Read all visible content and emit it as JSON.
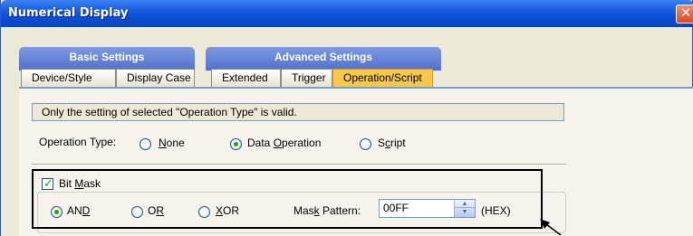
{
  "window": {
    "title": "Numerical Display",
    "close_glyph": "✕"
  },
  "tab_groups": [
    {
      "label": "Basic Settings"
    },
    {
      "label": "Advanced Settings"
    }
  ],
  "tabs": [
    {
      "label": "Device/Style",
      "active": false
    },
    {
      "label": "Display Case",
      "active": false
    },
    {
      "label": "Extended",
      "active": false
    },
    {
      "label": "Trigger",
      "active": false
    },
    {
      "label": "Operation/Script",
      "active": true
    }
  ],
  "info_text": "Only the setting of selected  \"Operation Type\" is valid.",
  "operation_type": {
    "label": "Operation Type:",
    "options": [
      {
        "pre": "",
        "key": "N",
        "post": "one",
        "selected": false
      },
      {
        "pre": "Data ",
        "key": "O",
        "post": "peration",
        "selected": true
      },
      {
        "pre": "S",
        "key": "c",
        "post": "ript",
        "selected": false
      }
    ]
  },
  "bit_mask": {
    "checked": true,
    "check_glyph": "✓",
    "label_pre": "Bit ",
    "label_key": "M",
    "label_post": "ask",
    "options": [
      {
        "pre": "AN",
        "key": "D",
        "post": "",
        "selected": true
      },
      {
        "pre": "O",
        "key": "R",
        "post": "",
        "selected": false
      },
      {
        "pre": "",
        "key": "X",
        "post": "OR",
        "selected": false
      }
    ],
    "pattern_label_pre": "Mas",
    "pattern_label_key": "k",
    "pattern_label_post": " Pattern:",
    "pattern_value": "00FF",
    "unit": "(HEX)",
    "spin_up": "▲",
    "spin_down": "▼"
  },
  "colors": {
    "active_tab": "#f7c84a",
    "radio_dot": "#21a121",
    "title_bar": "#0b4fd6"
  }
}
